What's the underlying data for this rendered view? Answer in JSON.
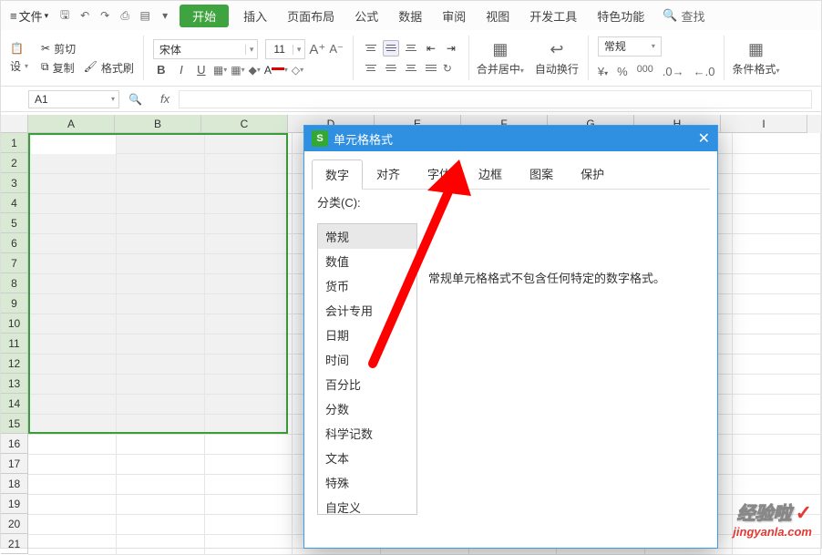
{
  "menu": {
    "file": "文件",
    "tabs": [
      "插入",
      "页面布局",
      "公式",
      "数据",
      "审阅",
      "视图",
      "开发工具",
      "特色功能"
    ],
    "start": "开始",
    "search": "查找"
  },
  "ribbon": {
    "cut": "剪切",
    "copy": "复制",
    "fmt_painter": "格式刷",
    "settings": "设",
    "font_name": "宋体",
    "font_size": "11",
    "merge_center": "合并居中",
    "auto_wrap": "自动换行",
    "number_format": "常规",
    "cond_fmt": "条件格式"
  },
  "formula": {
    "name_box": "A1"
  },
  "dialog": {
    "title": "单元格格式",
    "tabs": [
      "数字",
      "对齐",
      "字体",
      "边框",
      "图案",
      "保护"
    ],
    "cat_label": "分类(C):",
    "categories": [
      "常规",
      "数值",
      "货币",
      "会计专用",
      "日期",
      "时间",
      "百分比",
      "分数",
      "科学记数",
      "文本",
      "特殊",
      "自定义"
    ],
    "preview": "常规单元格格式不包含任何特定的数字格式。"
  },
  "sheet": {
    "cols_sel": [
      "A",
      "B",
      "C"
    ],
    "cols_rest": [
      "D",
      "E",
      "F",
      "G",
      "H",
      "I"
    ],
    "row_count": 21,
    "sel_rows": 15
  },
  "watermark": {
    "cn": "经验啦",
    "en": "jingyanla.com"
  }
}
